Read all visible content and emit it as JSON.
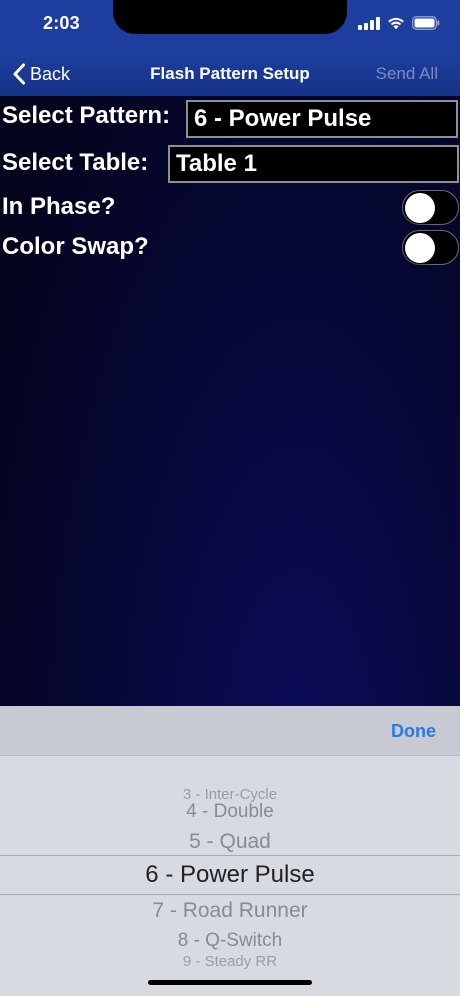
{
  "status_bar": {
    "time": "2:03",
    "signal_icon": "cellular-signal-icon",
    "wifi_icon": "wifi-icon",
    "battery_icon": "battery-icon"
  },
  "nav": {
    "back_label": "Back",
    "back_icon": "chevron-left-icon",
    "title": "Flash Pattern Setup",
    "send_all_label": "Send All"
  },
  "form": {
    "pattern_label": "Select Pattern:",
    "pattern_value": "6 - Power Pulse",
    "table_label": "Select Table:",
    "table_value": "Table 1",
    "in_phase_label": "In Phase?",
    "in_phase_on": false,
    "color_swap_label": "Color Swap?",
    "color_swap_on": false
  },
  "picker": {
    "done_label": "Done",
    "options": [
      "3 - Inter-Cycle",
      "4 - Double",
      "5 - Quad",
      "6 - Power Pulse",
      "7 - Road Runner",
      "8 - Q-Switch",
      "9 - Steady RR"
    ],
    "selected": "6 - Power Pulse"
  },
  "colors": {
    "nav_bar": "#1d3e9e",
    "background": "#070838",
    "accent": "#2a7ae2",
    "disabled": "#7a8cbf"
  }
}
